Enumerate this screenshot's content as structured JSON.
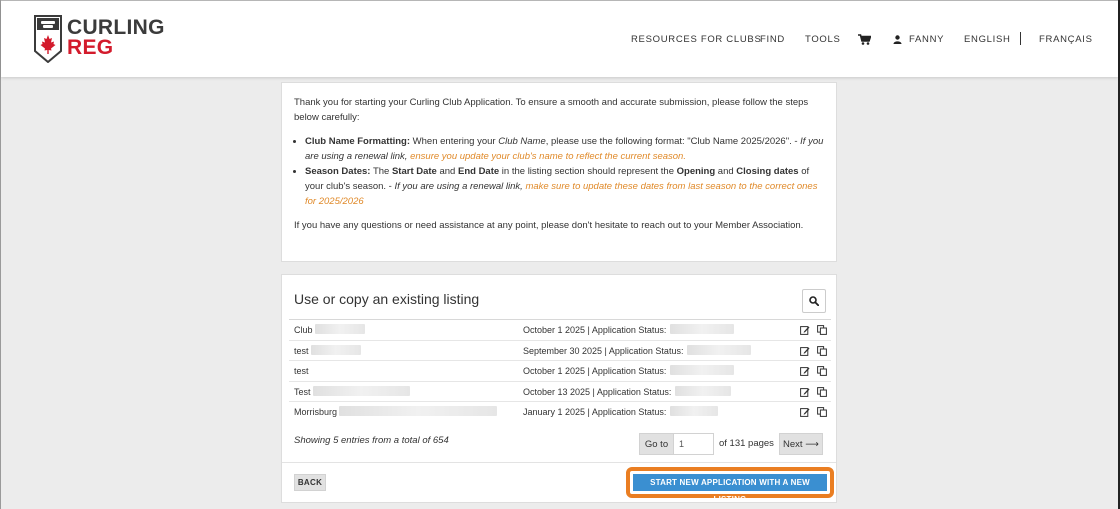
{
  "logo": {
    "line1": "CURLING",
    "line2": "REG"
  },
  "colors": {
    "accent_red": "#d31b2c",
    "primary_button": "#3a8fd1",
    "highlight": "#ea7e22",
    "link_orange": "#e08a2a"
  },
  "nav": {
    "resources": "RESOURCES FOR CLUBS",
    "find": "FIND",
    "tools": "TOOLS",
    "cart_icon": "cart-icon",
    "user_icon": "user-icon",
    "user": "FANNY",
    "english": "ENGLISH",
    "francais": "FRANÇAIS"
  },
  "info": {
    "intro": "Thank you for starting your Curling Club Application. To ensure a smooth and accurate submission, please follow the steps below carefully:",
    "club_label": "Club Name Formatting:",
    "club_text_1": " When entering your ",
    "club_text_italic": "Club Name",
    "club_text_2": ", please use the following format: \"Club Name 2025/2026\". - ",
    "club_renewal_italic": "If you are using a renewal link, ",
    "club_renewal_orange": "ensure you update your club's name to reflect the current season.",
    "season_label": "Season Dates:",
    "season_text_1": " The ",
    "season_start": "Start Date",
    "season_and": " and ",
    "season_end": "End Date",
    "season_text_2": " in the listing section should represent the ",
    "season_opening": "Opening",
    "season_and2": " and ",
    "season_closing": "Closing dates",
    "season_text_3": " of your club's season. - ",
    "season_renewal_italic": "If you are using a renewal link, ",
    "season_renewal_orange": "make sure to update these dates from last season to the correct ones for 2025/2026",
    "closing": "If you have any questions or need assistance at any point, please don't hesitate to reach out to your Member Association."
  },
  "listing": {
    "title": "Use or copy an existing listing",
    "search_icon": "search-icon",
    "rows": [
      {
        "name": "Club",
        "date": "October 1 2025 | Application Status:"
      },
      {
        "name": "test",
        "date": "September 30 2025 | Application Status:"
      },
      {
        "name": "test",
        "date": "October 1 2025 | Application Status:"
      },
      {
        "name": "Test",
        "date": "October 13 2025 | Application Status:"
      },
      {
        "name": "Morrisburg",
        "date": "January 1 2025 | Application Status:"
      }
    ],
    "showing": "Showing 5 entries from a total of 654",
    "goto": "Go to",
    "page_value": "1",
    "of_pages": "of 131 pages",
    "next": "Next",
    "back": "BACK",
    "start_new": "START NEW APPLICATION WITH A NEW LISTING"
  }
}
